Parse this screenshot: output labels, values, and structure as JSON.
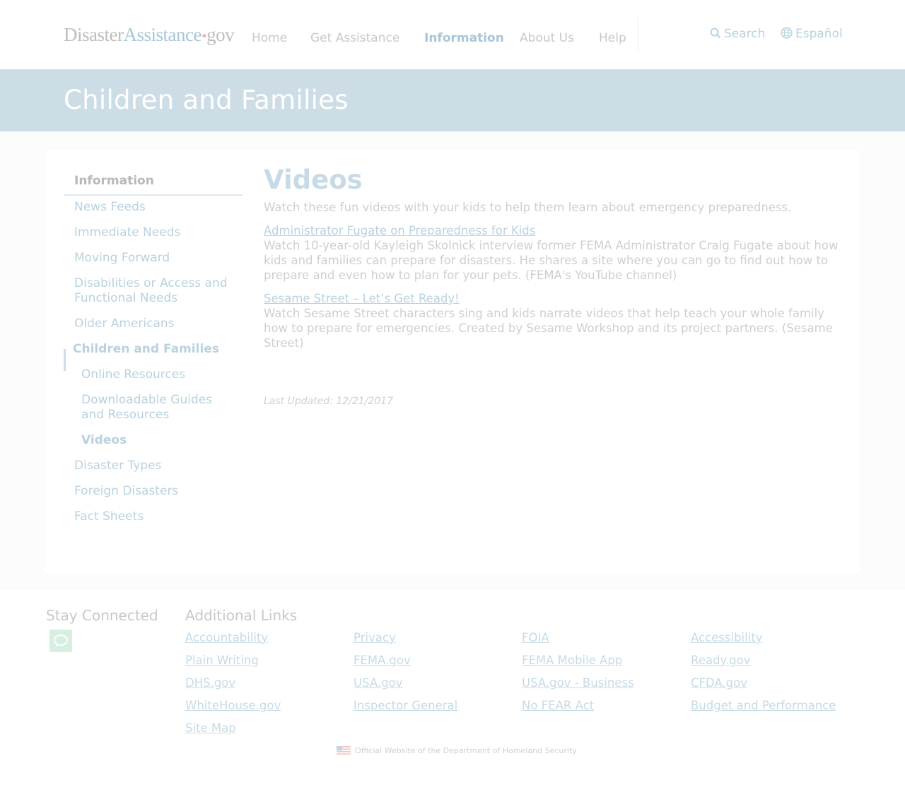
{
  "header": {
    "logo": {
      "part1": "Disaster",
      "part2": "Assistance",
      "dot": "•",
      "part3": "gov"
    },
    "nav": [
      "Home",
      "Get Assistance",
      "Information",
      "About Us",
      "Help"
    ],
    "search_label": "Search",
    "language_label": "Español"
  },
  "banner": {
    "title": "Children and Families"
  },
  "sidebar": {
    "heading": "Information",
    "items": [
      {
        "label": "News Feeds"
      },
      {
        "label": "Immediate Needs"
      },
      {
        "label": "Moving Forward"
      },
      {
        "label": "Disabilities or Access and Functional Needs"
      },
      {
        "label": "Older Americans"
      },
      {
        "label": "Children and Families"
      },
      {
        "label": "Online Resources"
      },
      {
        "label": "Downloadable Guides and Resources"
      },
      {
        "label": "Videos"
      },
      {
        "label": "Disaster Types"
      },
      {
        "label": "Foreign Disasters"
      },
      {
        "label": "Fact Sheets"
      }
    ]
  },
  "content": {
    "title": "Videos",
    "intro": "Watch these fun videos with your kids to help them learn about emergency preparedness.",
    "videos": [
      {
        "link": "Administrator Fugate on Preparedness for Kids",
        "description": "Watch 10-year-old Kayleigh Skolnick interview former FEMA Administrator Craig Fugate about how kids and families can prepare for disasters. He shares a site where you can go to find out how to prepare and even how to plan for your pets. (FEMA's YouTube channel)"
      },
      {
        "link": "Sesame Street – Let’s Get Ready!",
        "description": "Watch Sesame Street characters sing and kids narrate videos that help teach your whole family how to prepare for emergencies. Created by Sesame Workshop and its project partners. (Sesame Street)"
      }
    ],
    "last_updated": "Last Updated: 12/21/2017"
  },
  "footer": {
    "stay_connected": "Stay Connected",
    "additional_links": "Additional Links",
    "links": [
      "Accountability",
      "Privacy",
      "FOIA",
      "Accessibility",
      "Plain Writing",
      "FEMA.gov",
      "FEMA Mobile App",
      "Ready.gov",
      "DHS.gov",
      "USA.gov",
      "USA.gov - Business",
      "CFDA.gov",
      "WhiteHouse.gov",
      "Inspector General",
      "No FEAR Act",
      "Budget and Performance",
      "Site Map"
    ],
    "official": "Official Website of the Department of Homeland Security"
  },
  "colors": {
    "banner_bg": "#cddde6",
    "link": "#b9d2e0",
    "chat_button": "#d7efe0"
  },
  "icons": [
    "search-icon",
    "globe-icon",
    "chat-icon",
    "us-flag-icon"
  ]
}
